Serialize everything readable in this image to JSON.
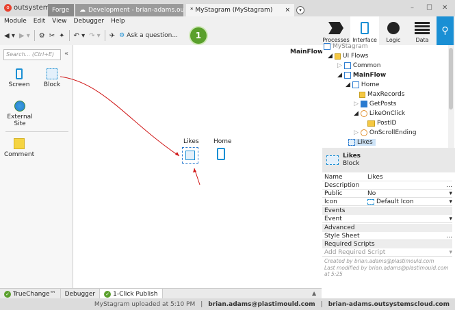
{
  "titlebar": {
    "brand": "outsystems",
    "tabs": [
      {
        "label": "Forge"
      },
      {
        "label": "Development - brian-adams.outs..."
      },
      {
        "label": "* MyStagram (MyStagram)"
      }
    ],
    "close": "×"
  },
  "menu": [
    "Module",
    "Edit",
    "View",
    "Debugger",
    "Help"
  ],
  "toolbar": {
    "ask": "Ask a question...",
    "publish_badge": "1"
  },
  "right_tabs": [
    "Processes",
    "Interface",
    "Logic",
    "Data"
  ],
  "left": {
    "search_placeholder": "Search... (Ctrl+E)",
    "widgets": [
      "Screen",
      "Block",
      "External Site",
      "Comment"
    ]
  },
  "canvas": {
    "flow_title": "MainFlow",
    "nodes": [
      "Likes",
      "Home"
    ]
  },
  "tree": [
    {
      "label": "MyStagram"
    },
    {
      "label": "UI Flows"
    },
    {
      "label": "Common"
    },
    {
      "label": "MainFlow"
    },
    {
      "label": "Home"
    },
    {
      "label": "MaxRecords"
    },
    {
      "label": "GetPosts"
    },
    {
      "label": "LikeOnClick"
    },
    {
      "label": "PostID"
    },
    {
      "label": "OnScrollEnding"
    },
    {
      "label": "Likes"
    }
  ],
  "props": {
    "head_name": "Likes",
    "head_type": "Block",
    "rows": [
      {
        "k": "Name",
        "v": "Likes"
      },
      {
        "k": "Description",
        "v": "..."
      },
      {
        "k": "Public",
        "v": "No"
      },
      {
        "k": "Icon",
        "v": "Default Icon"
      }
    ],
    "sec_events": "Events",
    "event_k": "Event",
    "sec_advanced": "Advanced",
    "stylesheet_k": "Style Sheet",
    "stylesheet_v": "...",
    "sec_required": "Required Scripts",
    "add_script": "Add Required Script",
    "created": "Created by brian.adams@plastimould.com",
    "modified": "Last modified by brian.adams@plastimould.com at 5:25"
  },
  "bottom_tabs": [
    "TrueChange™",
    "Debugger",
    "1-Click Publish"
  ],
  "status": {
    "uploaded": "MyStagram uploaded at 5:10 PM",
    "user": "brian.adams@plastimould.com",
    "server": "brian-adams.outsystemscloud.com"
  },
  "colors": {
    "accent": "#1a8fd4",
    "publish": "#5aa02c",
    "arrow": "#d01818"
  }
}
